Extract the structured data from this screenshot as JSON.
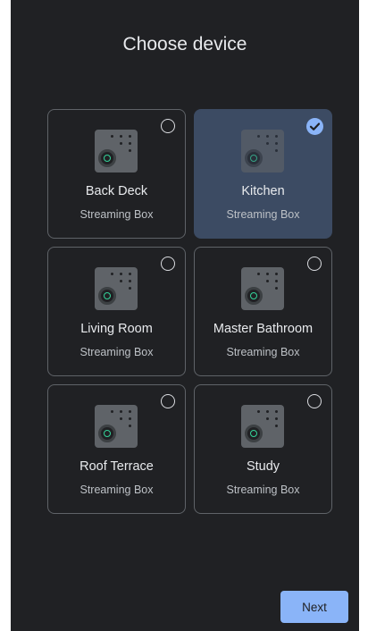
{
  "title": "Choose device",
  "devices": [
    {
      "name": "Back Deck",
      "type": "Streaming Box",
      "selected": false
    },
    {
      "name": "Kitchen",
      "type": "Streaming Box",
      "selected": true
    },
    {
      "name": "Living Room",
      "type": "Streaming Box",
      "selected": false
    },
    {
      "name": "Master Bathroom",
      "type": "Streaming Box",
      "selected": false
    },
    {
      "name": "Roof Terrace",
      "type": "Streaming Box",
      "selected": false
    },
    {
      "name": "Study",
      "type": "Streaming Box",
      "selected": false
    }
  ],
  "device_icon": "streaming-box-icon",
  "next_label": "Next",
  "colors": {
    "background": "#202124",
    "card_border": "#5f6368",
    "selected_card": "#3c4b63",
    "accent": "#8ab4f8",
    "text_primary": "#e8eaed",
    "text_secondary": "#bdc1c6"
  }
}
